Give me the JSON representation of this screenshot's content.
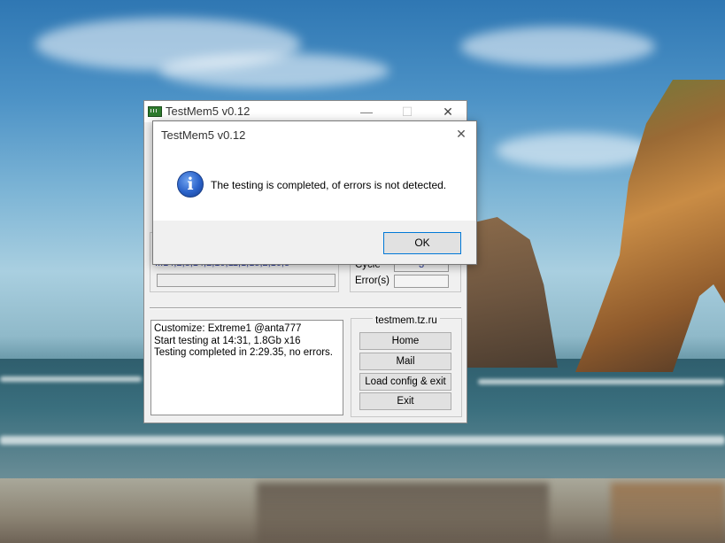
{
  "main_window": {
    "title": "TestMem5 v0.12",
    "sequence": "...14,2,8,14,2,10,11,1,15,2,16,3",
    "cycle_label": "Cycle",
    "cycle_value": "3",
    "errors_label": "Error(s)",
    "errors_value": "",
    "log_lines": [
      "Customize: Extreme1 @anta777",
      "Start testing at 14:31, 1.8Gb x16",
      "Testing completed in 2:29.35, no errors."
    ],
    "site": "testmem.tz.ru",
    "buttons": {
      "home": "Home",
      "mail": "Mail",
      "load": "Load config & exit",
      "exit": "Exit"
    },
    "controls": {
      "minimize": "—",
      "maximize": "☐",
      "close": "✕"
    }
  },
  "dialog": {
    "title": "TestMem5 v0.12",
    "message": "The testing is completed, of errors is not detected.",
    "ok_label": "OK",
    "close_glyph": "✕",
    "icon": "info-icon",
    "icon_glyph": "i"
  },
  "colors": {
    "accent": "#0078d7",
    "info_icon": "#2a62c9",
    "link_text": "#2a3a9a"
  }
}
